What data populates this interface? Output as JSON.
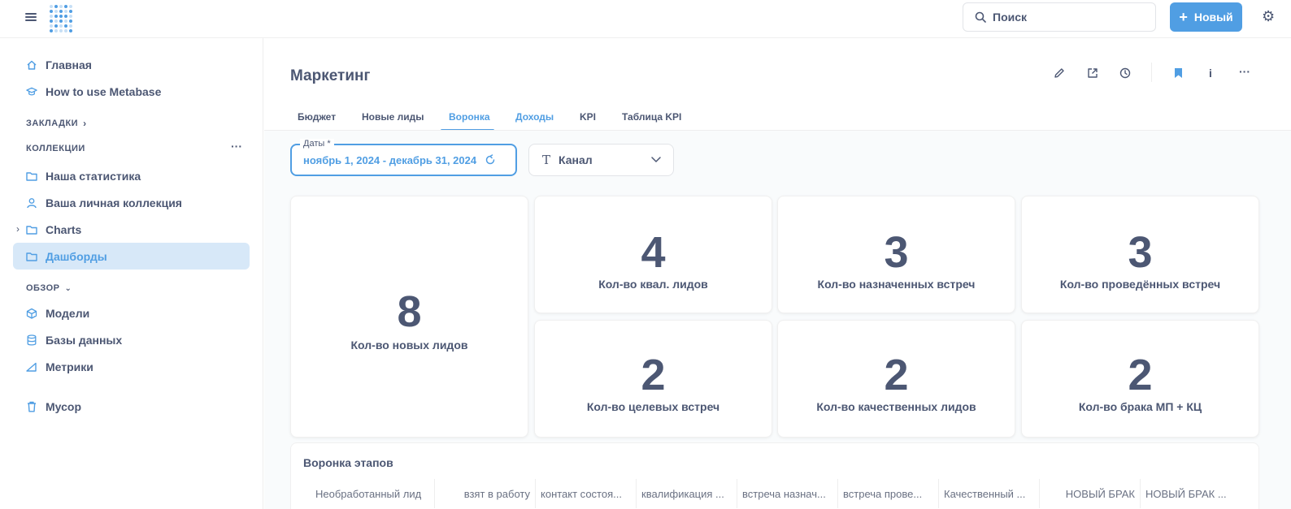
{
  "topbar": {
    "search_placeholder": "Поиск",
    "new_button_label": "Новый",
    "new_button_icon": "+"
  },
  "sidebar": {
    "main_items": [
      {
        "label": "Главная",
        "icon": "home-icon"
      },
      {
        "label": "How to use Metabase",
        "icon": "learn-icon"
      }
    ],
    "bookmarks_heading": "ЗАКЛАДКИ",
    "collections_heading": "КОЛЛЕКЦИИ",
    "collections": [
      {
        "label": "Наша статистика",
        "icon": "folder-icon"
      },
      {
        "label": "Ваша личная коллекция",
        "icon": "person-icon"
      },
      {
        "label": "Charts",
        "icon": "folder-icon"
      },
      {
        "label": "Дашборды",
        "icon": "folder-icon",
        "active": true
      }
    ],
    "browse_heading": "ОБЗОР",
    "browse_items": [
      {
        "label": "Модели",
        "icon": "model-icon"
      },
      {
        "label": "Базы данных",
        "icon": "database-icon"
      },
      {
        "label": "Метрики",
        "icon": "metric-icon"
      }
    ],
    "trash_label": "Мусор"
  },
  "dashboard": {
    "title": "Маркетинг",
    "tabs": [
      "Бюджет",
      "Новые лиды",
      "Воронка",
      "Доходы",
      "KPI",
      "Таблица KPI"
    ],
    "active_tab": "Воронка"
  },
  "filters": {
    "date_label": "Даты *",
    "date_value": "ноябрь 1, 2024 - декабрь 31, 2024",
    "channel_label": "Канал"
  },
  "cards": [
    {
      "value": "8",
      "caption": "Кол-во новых лидов"
    },
    {
      "value": "4",
      "caption": "Кол-во квал. лидов"
    },
    {
      "value": "3",
      "caption": "Кол-во назначенных встреч"
    },
    {
      "value": "3",
      "caption": "Кол-во проведённых встреч"
    },
    {
      "value": "2",
      "caption": "Кол-во целевых встреч"
    },
    {
      "value": "2",
      "caption": "Кол-во качественных лидов"
    },
    {
      "value": "2",
      "caption": "Кол-во брака МП + КЦ"
    }
  ],
  "funnel": {
    "title": "Воронка этапов",
    "columns": [
      "Необработанный лид",
      "взят в работу",
      "контакт состоя...",
      "квалификация ...",
      "встреча назнач...",
      "встреча прове...",
      "Качественный ...",
      "НОВЫЙ БРАК",
      "НОВЫЙ БРАК ..."
    ]
  },
  "colors": {
    "accent": "#509ee3",
    "text": "#4c5773",
    "active_bg": "#d7e8f8"
  }
}
